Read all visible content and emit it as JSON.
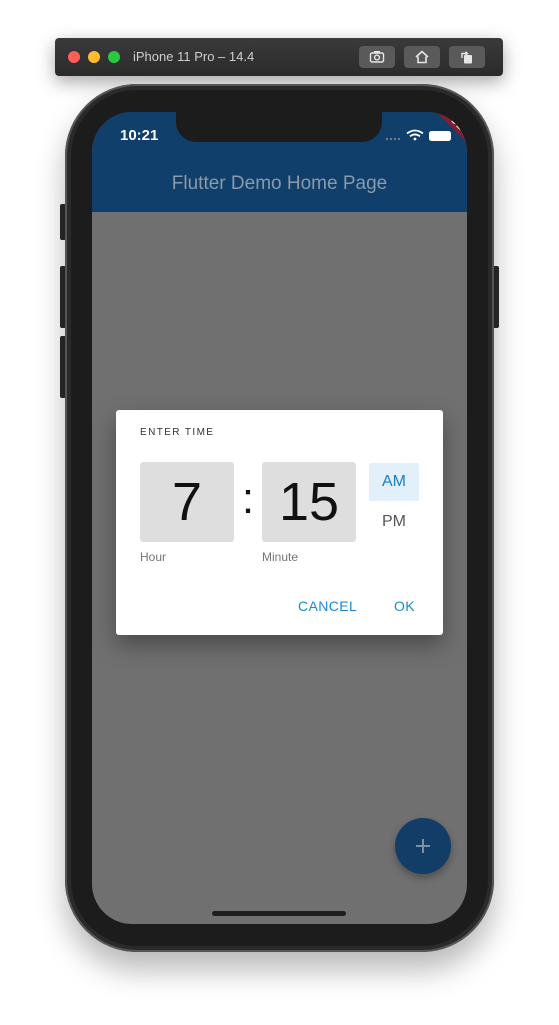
{
  "simulator": {
    "title": "iPhone 11 Pro – 14.4",
    "buttons": [
      "screenshot-icon",
      "home-icon",
      "rotate-icon"
    ]
  },
  "status_bar": {
    "time": "10:21",
    "debug_banner": "DEBUG"
  },
  "app_bar": {
    "title": "Flutter Demo Home Page"
  },
  "dialog": {
    "heading": "ENTER TIME",
    "hour": "7",
    "minute": "15",
    "separator": ":",
    "hour_label": "Hour",
    "minute_label": "Minute",
    "am_label": "AM",
    "pm_label": "PM",
    "selected_period": "AM",
    "cancel_label": "CANCEL",
    "ok_label": "OK"
  },
  "fab": {
    "icon": "plus-icon"
  },
  "colors": {
    "app_bar": "#0f3f6a",
    "accent": "#1a8ad4",
    "overlay": "#707070"
  }
}
